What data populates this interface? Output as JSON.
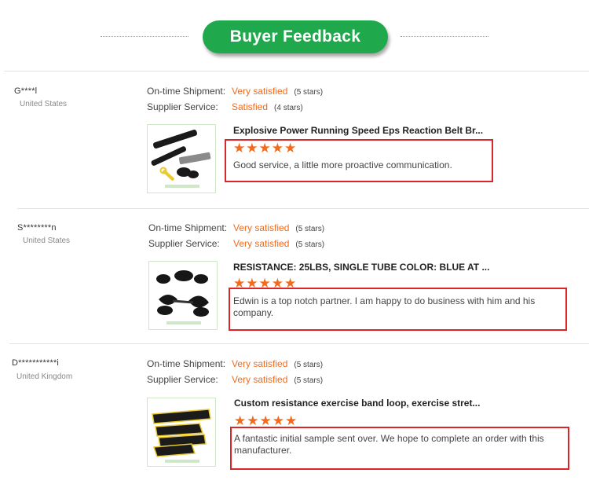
{
  "header": {
    "title": "Buyer Feedback"
  },
  "labels": {
    "shipment": "On-time Shipment:",
    "service": "Supplier Service:"
  },
  "star_glyphs": "★★★★★",
  "colors": {
    "accent_green": "#1fa94c",
    "rating_orange": "#f26a1b",
    "highlight_red": "#d8262b"
  },
  "icons": [
    "star-icon",
    "product-thumbnail"
  ],
  "feedback": [
    {
      "buyer": "G****l",
      "country": "United States",
      "shipment": {
        "value": "Very satisfied",
        "stars": "(5 stars)"
      },
      "service": {
        "value": "Satisfied",
        "stars": "(4 stars)"
      },
      "product_title": "Explosive Power Running Speed Eps Reaction Belt Br...",
      "rating": 5,
      "comment": "Good service, a little more proactive communication."
    },
    {
      "buyer": "S********n",
      "country": "United States",
      "shipment": {
        "value": "Very satisfied",
        "stars": "(5 stars)"
      },
      "service": {
        "value": "Very satisfied",
        "stars": "(5 stars)"
      },
      "product_title": "RESISTANCE: 25LBS, SINGLE TUBE COLOR: BLUE AT ...",
      "rating": 5,
      "comment": "Edwin is a top notch partner. I am happy to do business with him and his company."
    },
    {
      "buyer": "D***********i",
      "country": "United Kingdom",
      "shipment": {
        "value": "Very satisfied",
        "stars": "(5 stars)"
      },
      "service": {
        "value": "Very satisfied",
        "stars": "(5 stars)"
      },
      "product_title": "Custom resistance exercise band loop, exercise stret...",
      "rating": 5,
      "comment": "A fantastic initial sample sent over. We hope to complete an order with this manufacturer."
    }
  ]
}
